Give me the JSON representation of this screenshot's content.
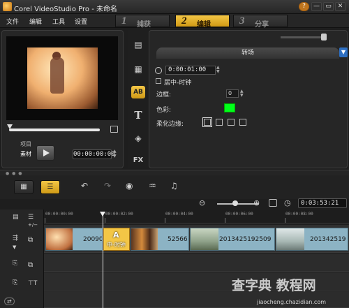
{
  "window": {
    "title": "Corel VideoStudio Pro - 未命名",
    "help_label": "?",
    "minimize_label": "—",
    "maximize_label": "▭",
    "close_label": "✕"
  },
  "menu": [
    "文件",
    "编辑",
    "工具",
    "设置"
  ],
  "steps": [
    {
      "num": "1",
      "label": "捕获"
    },
    {
      "num": "2",
      "label": "编辑"
    },
    {
      "num": "3",
      "label": "分享"
    }
  ],
  "preview": {
    "mode_project": "项目",
    "mode_clip": "素材",
    "timecode": "00:00:00:00"
  },
  "options": {
    "tab_label": "转场",
    "duration": "0:00:01:00",
    "checkbox_label": "居中-时钟",
    "border_label": "边框:",
    "border_value": "0",
    "color_label": "色彩:",
    "color_value": "#00ff1a",
    "soften_label": "柔化边缘:"
  },
  "timeline": {
    "timecode": "0:03:53:21",
    "ruler": [
      "00:00:00:00",
      "00:00:02:00",
      "00:00:04:00",
      "00:00:06:00",
      "00:00:08:00"
    ],
    "clips": [
      {
        "label": "20090"
      },
      {
        "label": "中-时钟"
      },
      {
        "label": "52566"
      },
      {
        "label": "2013425192509"
      },
      {
        "label": "201342519"
      }
    ]
  },
  "watermark": {
    "brand": "查字典 教程网",
    "url": "jiaocheng.chazidian.com"
  }
}
